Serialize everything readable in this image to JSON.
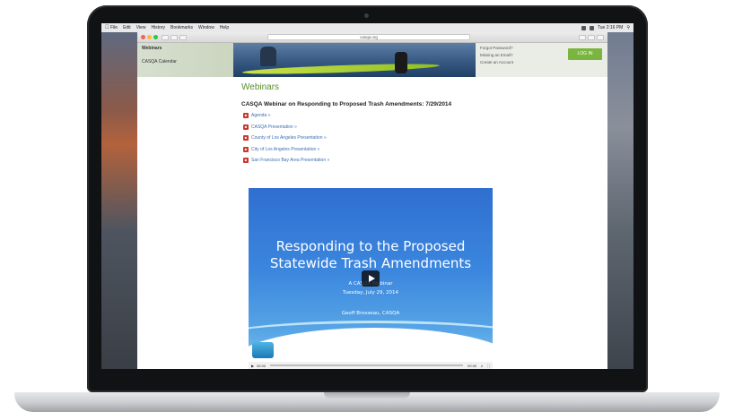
{
  "menubar": {
    "items": [
      "File",
      "Edit",
      "View",
      "History",
      "Bookmarks",
      "Window",
      "Help"
    ],
    "clock": "Tue 2:16 PM"
  },
  "browser": {
    "url": "casqa.org"
  },
  "sidebar": {
    "title": "Webinars",
    "items": [
      "CASQA Calendar"
    ]
  },
  "account": {
    "forgot_password": "Forgot Password?",
    "missing_email": "Missing an Email?",
    "create_account": "Create an Account",
    "login_label": "LOG IN"
  },
  "page": {
    "title": "Webinars",
    "webinar_heading": "CASQA Webinar on Responding to Proposed Trash Amendments: 7/29/2014",
    "links": [
      "Agenda »",
      "CASQA Presentation »",
      "County of Los Angeles Presentation »",
      "City of Los Angeles Presentation »",
      "San Francisco Bay Area Presentation »"
    ]
  },
  "video": {
    "title_line1": "Responding to the Proposed",
    "title_line2": "Statewide Trash Amendments",
    "subtitle1": "A CASQA Webinar",
    "subtitle2": "Tuesday, July 29, 2014",
    "presenter": "Geoff Brosseau, CASQA",
    "time_current": "00:00",
    "time_total": "00:00"
  },
  "colors": {
    "accent_green": "#5a8f2e",
    "login_green": "#7ab53f",
    "link_blue": "#3b6fb1",
    "pdf_red": "#c9362c"
  }
}
